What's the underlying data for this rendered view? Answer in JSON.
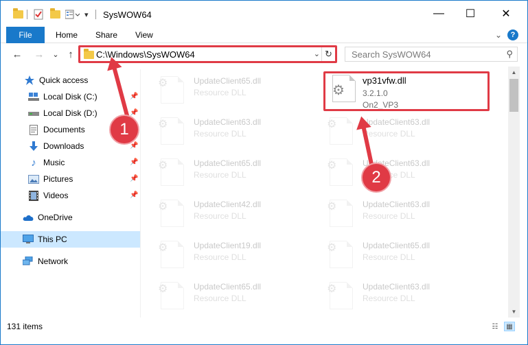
{
  "window": {
    "title": "SysWOW64",
    "minimize_glyph": "—",
    "maximize_glyph": "☐",
    "close_glyph": "✕"
  },
  "ribbon": {
    "file": "File",
    "home": "Home",
    "share": "Share",
    "view": "View",
    "help": "?",
    "expand_glyph": "⌄"
  },
  "nav": {
    "back": "←",
    "forward": "→",
    "recent": "⌄",
    "up": "↑",
    "address": "C:\\Windows\\SysWOW64",
    "address_dropdown": "⌄",
    "refresh": "↻",
    "search_placeholder": "Search SysWOW64",
    "search_icon": "⚲"
  },
  "sidebar": {
    "items": [
      {
        "label": "Quick access",
        "icon": "star-icon",
        "pinned": false
      },
      {
        "label": "Local Disk (C:)",
        "icon": "drive-icon",
        "pinned": true
      },
      {
        "label": "Local Disk (D:)",
        "icon": "drive-icon",
        "pinned": true
      },
      {
        "label": "Documents",
        "icon": "documents-icon",
        "pinned": true
      },
      {
        "label": "Downloads",
        "icon": "download-icon",
        "pinned": true
      },
      {
        "label": "Music",
        "icon": "music-icon",
        "pinned": true
      },
      {
        "label": "Pictures",
        "icon": "pictures-icon",
        "pinned": true
      },
      {
        "label": "Videos",
        "icon": "videos-icon",
        "pinned": true
      },
      {
        "label": "OneDrive",
        "icon": "cloud-icon",
        "pinned": false
      },
      {
        "label": "This PC",
        "icon": "computer-icon",
        "pinned": false,
        "selected": true
      },
      {
        "label": "Network",
        "icon": "network-icon",
        "pinned": false
      }
    ],
    "pin_glyph": "📌"
  },
  "files": {
    "featured": {
      "name": "vp31vfw.dll",
      "version": "3.2.1.0",
      "company": "On2_VP3"
    },
    "left_column": [
      {
        "name": "UpdateClient65.dll",
        "type": "Resource DLL"
      },
      {
        "name": "UpdateClient63.dll",
        "type": "Resource DLL"
      },
      {
        "name": "UpdateClient65.dll",
        "type": "Resource DLL"
      },
      {
        "name": "UpdateClient42.dll",
        "type": "Resource DLL"
      },
      {
        "name": "UpdateClient19.dll",
        "type": "Resource DLL"
      },
      {
        "name": "UpdateClient65.dll",
        "type": "Resource DLL"
      }
    ],
    "right_column": [
      {
        "name": "UpdateClient63.dll",
        "type": "Resource DLL"
      },
      {
        "name": "UpdateClient63.dll",
        "type": "Resource DLL"
      },
      {
        "name": "UpdateClient63.dll",
        "type": "Resource DLL"
      },
      {
        "name": "UpdateClient65.dll",
        "type": "Resource DLL"
      },
      {
        "name": "UpdateClient63.dll",
        "type": "Resource DLL"
      }
    ]
  },
  "status": {
    "item_count": "131 items",
    "details_view_glyph": "☷",
    "tiles_view_glyph": "▦"
  },
  "annotations": {
    "step1": "1",
    "step2": "2",
    "color": "#e03a45"
  },
  "colors": {
    "accent": "#1979ca",
    "selection": "#cce8ff"
  }
}
